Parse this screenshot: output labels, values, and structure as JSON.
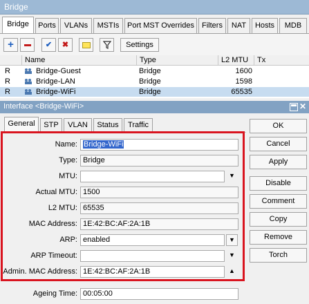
{
  "bridge": {
    "title": "Bridge",
    "tabs": [
      "Bridge",
      "Ports",
      "VLANs",
      "MSTIs",
      "Port MST Overrides",
      "Filters",
      "NAT",
      "Hosts",
      "MDB"
    ],
    "settings_label": "Settings",
    "columns": [
      "Name",
      "Type",
      "L2 MTU",
      "Tx"
    ],
    "rows": [
      {
        "flag": "R",
        "name": "Bridge-Guest",
        "type": "Bridge",
        "l2mtu": "1600"
      },
      {
        "flag": "R",
        "name": "Bridge-LAN",
        "type": "Bridge",
        "l2mtu": "1598"
      },
      {
        "flag": "R",
        "name": "Bridge-WiFi",
        "type": "Bridge",
        "l2mtu": "65535"
      }
    ]
  },
  "dialog": {
    "title": "Interface <Bridge-WiFi>",
    "tabs": [
      "General",
      "STP",
      "VLAN",
      "Status",
      "Traffic"
    ],
    "fields": {
      "name_label": "Name:",
      "name_value": "Bridge-WiFi",
      "type_label": "Type:",
      "type_value": "Bridge",
      "mtu_label": "MTU:",
      "mtu_value": "",
      "actual_mtu_label": "Actual MTU:",
      "actual_mtu_value": "1500",
      "l2mtu_label": "L2 MTU:",
      "l2mtu_value": "65535",
      "mac_label": "MAC Address:",
      "mac_value": "1E:42:BC:AF:2A:1B",
      "arp_label": "ARP:",
      "arp_value": "enabled",
      "arp_timeout_label": "ARP Timeout:",
      "arp_timeout_value": "",
      "admin_mac_label": "Admin. MAC Address:",
      "admin_mac_value": "1E:42:BC:AF:2A:1B",
      "ageing_label": "Ageing Time:",
      "ageing_value": "00:05:00"
    },
    "buttons": [
      "OK",
      "Cancel",
      "Apply",
      "Disable",
      "Comment",
      "Copy",
      "Remove",
      "Torch"
    ]
  },
  "colors": {
    "highlight": "#d9141f",
    "selection": "#c7dcf0",
    "titlebar": "#82a2c3"
  }
}
